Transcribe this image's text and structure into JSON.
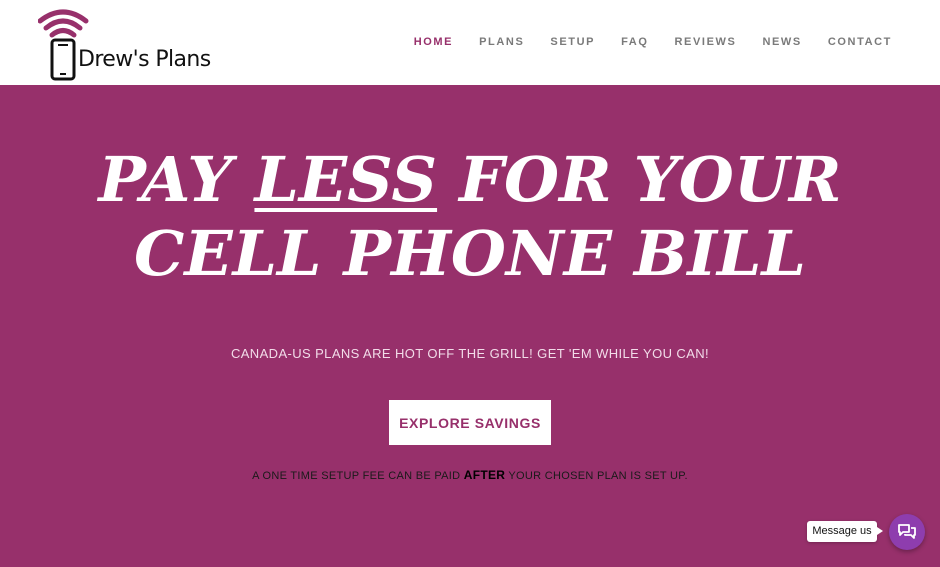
{
  "brand": {
    "name": "Drew's Plans",
    "accent_color": "#97306b",
    "logo_icon": "phone-signal-icon"
  },
  "nav": {
    "items": [
      {
        "label": "HOME",
        "active": true
      },
      {
        "label": "PLANS",
        "active": false
      },
      {
        "label": "SETUP",
        "active": false
      },
      {
        "label": "FAQ",
        "active": false
      },
      {
        "label": "REVIEWS",
        "active": false
      },
      {
        "label": "NEWS",
        "active": false
      },
      {
        "label": "CONTACT",
        "active": false
      }
    ]
  },
  "hero": {
    "background_color": "#97306b",
    "headline_pre": "PAY ",
    "headline_emphasis": "LESS",
    "headline_post": " FOR YOUR",
    "headline_line2": "CELL PHONE BILL",
    "subtext": "CANADA-US PLANS ARE HOT OFF THE GRILL! GET 'EM WHILE YOU CAN!",
    "cta_label": "EXPLORE SAVINGS",
    "fee_note_pre": "A ONE TIME SETUP FEE CAN BE PAID ",
    "fee_note_strong": "AFTER",
    "fee_note_post": " YOUR CHOSEN PLAN IS SET UP."
  },
  "chat": {
    "bubble_label": "Message us",
    "button_icon": "chat-icon",
    "button_color": "#8e3dae"
  }
}
